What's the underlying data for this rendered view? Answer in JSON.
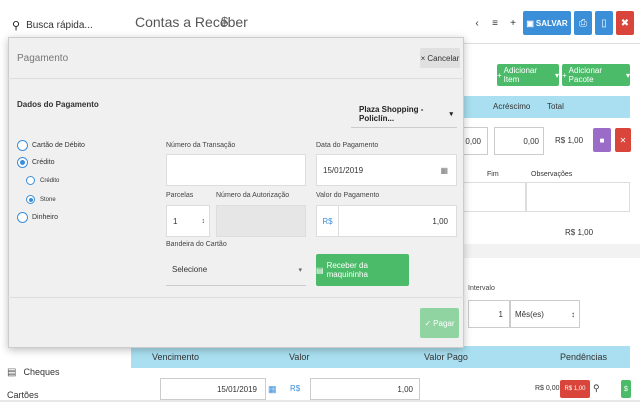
{
  "sidebar": {
    "search_placeholder": "Busca rápida...",
    "cheques_label": "Cheques",
    "next_label": "Cartões"
  },
  "header": {
    "title": "Contas a Receber",
    "currency_icon": "$",
    "save_label": "SALVAR"
  },
  "background": {
    "add_item_label": "Adicionar Item",
    "add_package_label": "Adicionar Pacote",
    "col_acrescimo": "Acréscimo",
    "col_total": "Total",
    "acrescimo_a": "0,00",
    "acrescimo_b": "0,00",
    "row_total": "R$ 1,00",
    "col_fim": "Fim",
    "col_observacoes": "Observações",
    "total_sum": "R$ 1,00",
    "intervalo_label": "Intervalo",
    "intervalo_value": "1",
    "intervalo_unit": "Mês(es)"
  },
  "table": {
    "headers": [
      "Vencimento",
      "Valor",
      "Valor Pago",
      "Pendências"
    ],
    "rows": [
      {
        "vencimento": "15/01/2019",
        "currency": "R$",
        "valor": "1,00",
        "valor_pago": "R$ 0,00",
        "pendencia": "R$ 1,00"
      }
    ]
  },
  "modal": {
    "title": "Pagamento",
    "cancel_label": "Cancelar",
    "section_title": "Dados do Pagamento",
    "store_select": "Plaza Shopping - Policlín...",
    "payment_types": [
      {
        "label": "Cartão de Débito",
        "selected": false
      },
      {
        "label": "Crédito",
        "selected": true
      },
      {
        "label": "Dinheiro",
        "selected": false
      }
    ],
    "credit_options": [
      {
        "label": "Crédito",
        "selected": false
      },
      {
        "label": "Stone",
        "selected": true
      }
    ],
    "fields": {
      "transaction_label": "Número da Transação",
      "transaction_value": "",
      "date_label": "Data do Pagamento",
      "date_value": "15/01/2019",
      "installments_label": "Parcelas",
      "installments_value": "1",
      "authorization_label": "Número da Autorização",
      "amount_label": "Valor do Pagamento",
      "amount_currency": "R$",
      "amount_value": "1,00",
      "brand_label": "Bandeira do Cartão",
      "brand_value": "Selecione"
    },
    "receive_button": "Receber da maquininha",
    "pay_button": "Pagar"
  },
  "colors": {
    "primary": "#3b8fd9",
    "success": "#4cbb69",
    "danger": "#d9453b",
    "table_header": "#a9dff0"
  },
  "icons": [
    "search-icon",
    "dollar-icon",
    "chevron-left-icon",
    "list-icon",
    "plus-icon",
    "save-icon",
    "print-icon",
    "document-icon",
    "trash-icon",
    "calendar-icon",
    "cash-register-icon",
    "check-icon",
    "close-icon",
    "caret-down-icon",
    "cheque-icon",
    "search-magnifier-icon"
  ]
}
